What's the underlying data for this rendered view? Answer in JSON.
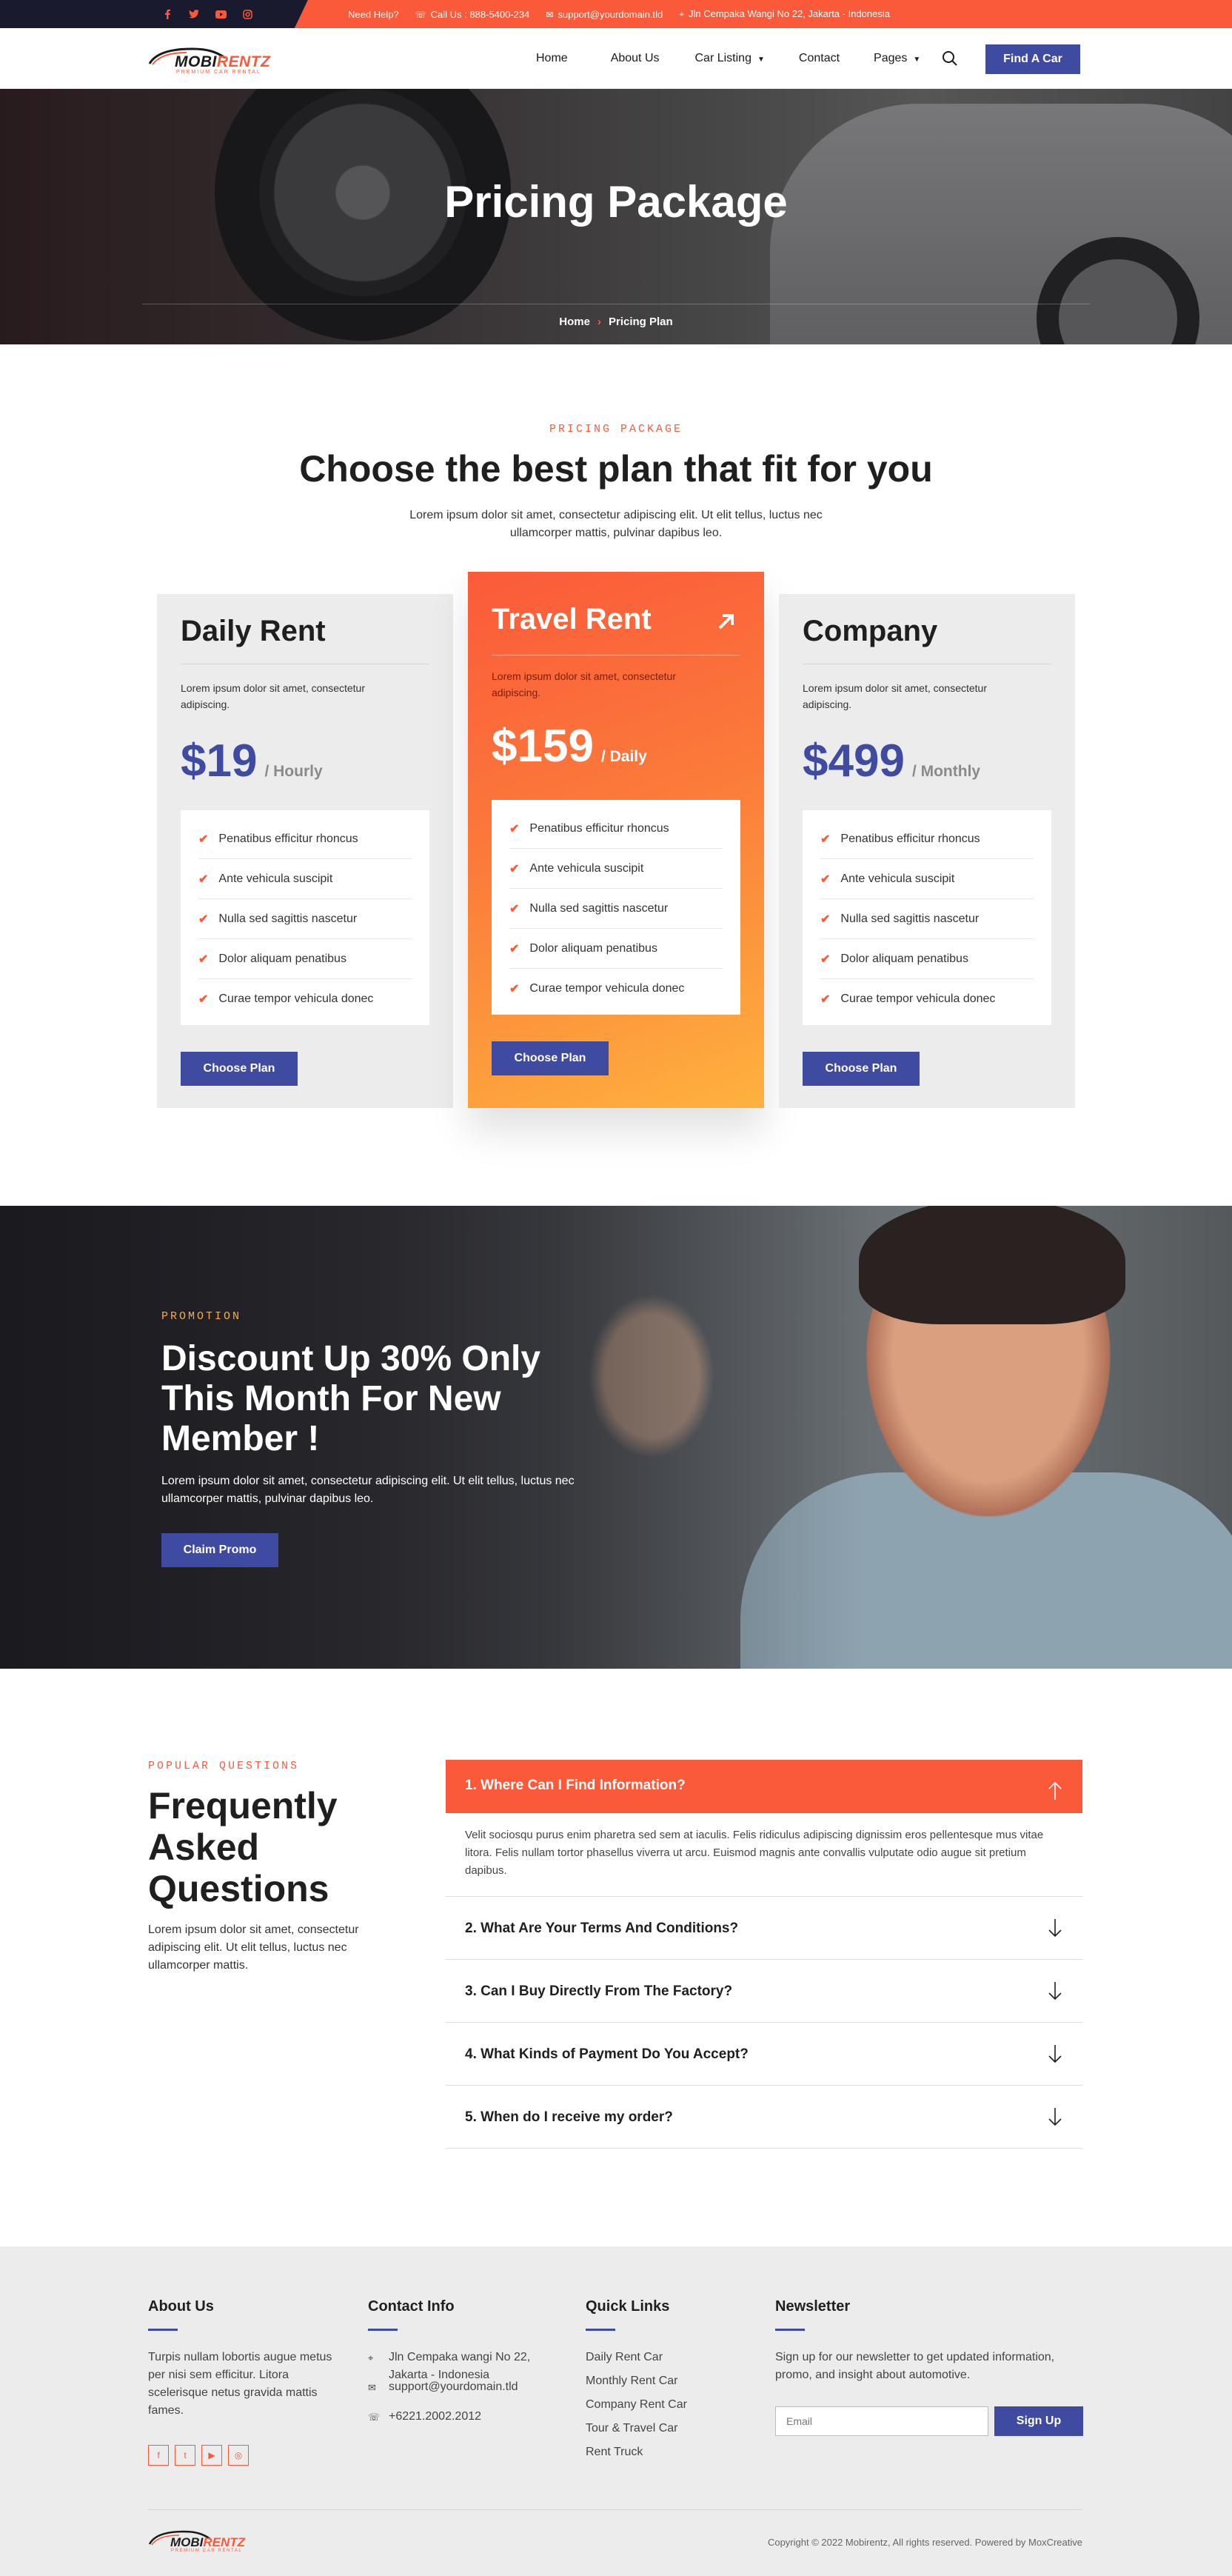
{
  "topbar": {
    "social": [
      "facebook-icon",
      "twitter-icon",
      "youtube-icon",
      "instagram-icon"
    ],
    "help": "Need Help?",
    "call": "Call Us : 888-5400-234",
    "email": "support@yourdomain.tld",
    "address": "Jln Cempaka Wangi No 22, Jakarta - Indonesia"
  },
  "brand": {
    "name_a": "MOBI",
    "name_b": "RENTZ",
    "tagline": "PREMIUM CAR RENTAL"
  },
  "nav": {
    "home": "Home",
    "about": "About Us",
    "car_listing": "Car Listing",
    "contact": "Contact",
    "pages": "Pages",
    "cta": "Find A Car"
  },
  "hero": {
    "title": "Pricing Package",
    "crumb_home": "Home",
    "crumb_current": "Pricing Plan"
  },
  "pricing": {
    "eyebrow": "PRICING PACKAGE",
    "title": "Choose the best plan that fit for you",
    "desc": "Lorem ipsum dolor sit amet, consectetur adipiscing elit. Ut elit tellus, luctus nec ullamcorper mattis, pulvinar dapibus leo.",
    "plans": [
      {
        "name": "Daily Rent",
        "desc": "Lorem ipsum dolor sit amet, consectetur adipiscing.",
        "price": "$19",
        "period": "/ Hourly",
        "features": [
          "Penatibus efficitur rhoncus",
          "Ante vehicula suscipit",
          "Nulla sed sagittis nascetur",
          "Dolor aliquam penatibus",
          "Curae tempor vehicula donec"
        ],
        "button": "Choose Plan"
      },
      {
        "name": "Travel Rent",
        "desc": "Lorem ipsum dolor sit amet, consectetur adipiscing.",
        "price": "$159",
        "period": "/ Daily",
        "features": [
          "Penatibus efficitur rhoncus",
          "Ante vehicula suscipit",
          "Nulla sed sagittis nascetur",
          "Dolor aliquam penatibus",
          "Curae tempor vehicula donec"
        ],
        "button": "Choose Plan"
      },
      {
        "name": "Company",
        "desc": "Lorem ipsum dolor sit amet, consectetur adipiscing.",
        "price": "$499",
        "period": "/ Monthly",
        "features": [
          "Penatibus efficitur rhoncus",
          "Ante vehicula suscipit",
          "Nulla sed sagittis nascetur",
          "Dolor aliquam penatibus",
          "Curae tempor vehicula donec"
        ],
        "button": "Choose Plan"
      }
    ]
  },
  "promo": {
    "eyebrow": "PROMOTION",
    "title": "Discount Up 30% Only This Month For New Member !",
    "desc": "Lorem ipsum dolor sit amet, consectetur adipiscing elit. Ut elit tellus, luctus nec ullamcorper mattis, pulvinar dapibus leo.",
    "button": "Claim Promo"
  },
  "faq": {
    "eyebrow": "POPULAR QUESTIONS",
    "title": "Frequently Asked Questions",
    "desc": "Lorem ipsum dolor sit amet, consectetur adipiscing elit. Ut elit tellus, luctus nec ullamcorper mattis.",
    "items": [
      {
        "q": "1. Where Can I Find Information?",
        "a": "Velit sociosqu purus enim pharetra sed sem at iaculis. Felis ridiculus adipiscing dignissim eros pellentesque mus vitae litora. Felis nullam tortor phasellus viverra ut arcu. Euismod magnis ante convallis vulputate odio augue sit pretium dapibus."
      },
      {
        "q": "2. What Are Your Terms And Conditions?"
      },
      {
        "q": "3. Can I Buy Directly From The Factory?"
      },
      {
        "q": "4. What Kinds of Payment Do You Accept?"
      },
      {
        "q": "5. When do I receive my order?"
      }
    ]
  },
  "footer": {
    "about_title": "About Us",
    "about_text": "Turpis nullam lobortis augue metus per nisi sem efficitur. Litora scelerisque netus gravida mattis fames.",
    "contact_title": "Contact Info",
    "contact_address": "Jln Cempaka wangi No 22, Jakarta - Indonesia",
    "contact_email": "support@yourdomain.tld",
    "contact_phone": "+6221.2002.2012",
    "links_title": "Quick Links",
    "links": [
      "Daily Rent Car",
      "Monthly Rent Car",
      "Company Rent Car",
      "Tour & Travel Car",
      "Rent Truck"
    ],
    "news_title": "Newsletter",
    "news_text": "Sign up for our newsletter to get updated information, promo, and insight about automotive.",
    "news_placeholder": "Email",
    "news_button": "Sign Up",
    "copyright": "Copyright © 2022 Mobirentz, All rights reserved. Powered by MoxCreative"
  },
  "colors": {
    "accent": "#fb5a3a",
    "primary": "#3f4aa1",
    "promo_eyebrow": "#fea83e",
    "footer_bg": "#ececec"
  }
}
